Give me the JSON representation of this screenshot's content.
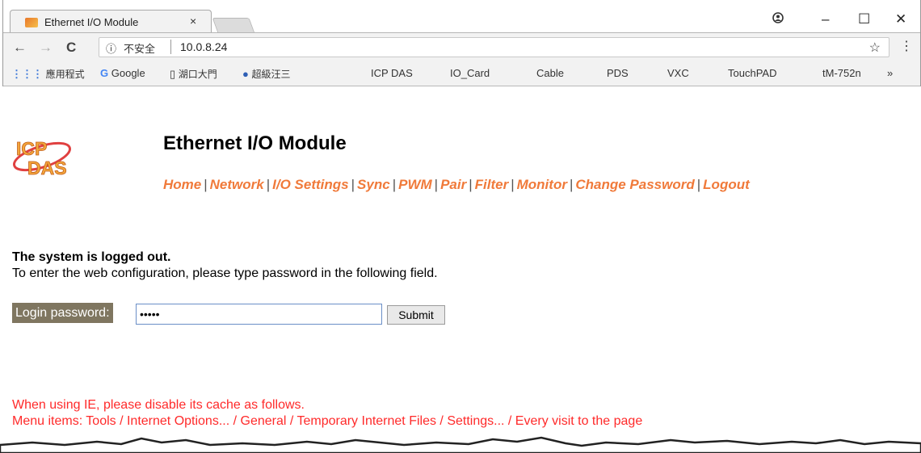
{
  "browser": {
    "tab_title": "Ethernet I/O Module",
    "tab_close": "×",
    "window_controls": {
      "account": "◔",
      "minimize": "–",
      "maximize": "☐",
      "close": "✕"
    },
    "nav": {
      "back": "←",
      "forward": "→",
      "reload": "C"
    },
    "address": {
      "info_icon": "ⓘ",
      "insecure_label": "不安全",
      "url": "10.0.8.24"
    },
    "bookmarks": [
      {
        "label": "應用程式",
        "icon": "apps-icon"
      },
      {
        "label": "Google",
        "icon": "google-icon"
      },
      {
        "label": "湖口大門",
        "icon": "page-icon"
      },
      {
        "label": "超級汪三",
        "icon": "globe-icon"
      },
      {
        "label": "ICP DAS"
      },
      {
        "label": "IO_Card"
      },
      {
        "label": "Cable"
      },
      {
        "label": "PDS"
      },
      {
        "label": "VXC"
      },
      {
        "label": "TouchPAD"
      },
      {
        "label": "tM-752n"
      }
    ],
    "bookmarks_more": "»"
  },
  "page": {
    "title": "Ethernet I/O Module",
    "nav": [
      "Home",
      "Network",
      "I/O Settings",
      "Sync",
      "PWM",
      "Pair",
      "Filter",
      "Monitor",
      "Change Password",
      "Logout"
    ],
    "status_title": "The system is logged out.",
    "status_desc": "To enter the web configuration, please type password in the following field.",
    "login_label": "Login password:",
    "login_value": "•••••",
    "submit_label": "Submit",
    "ie_note_1": "When using IE, please disable its cache as follows.",
    "ie_note_2": "Menu items: Tools / Internet Options... / General / Temporary Internet Files / Settings... / Every visit to the page"
  },
  "colors": {
    "nav_link": "#f07a3a",
    "ie_note": "#ff2a2a",
    "login_label_bg": "#7f7660"
  }
}
